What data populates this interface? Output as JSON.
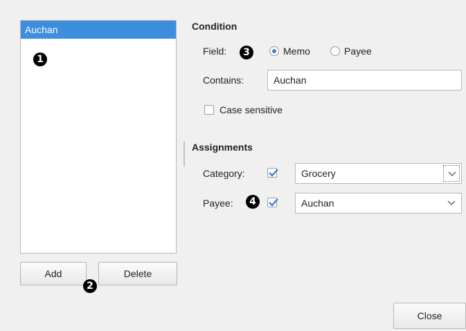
{
  "rules_list": {
    "selected_item": "Auchan"
  },
  "markers": [
    "1",
    "2",
    "3",
    "4"
  ],
  "buttons": {
    "add": "Add",
    "delete": "Delete",
    "close": "Close"
  },
  "condition": {
    "heading": "Condition",
    "field_label": "Field:",
    "field_options": [
      "Memo",
      "Payee"
    ],
    "field_selected": "Memo",
    "contains_label": "Contains:",
    "contains_value": "Auchan",
    "case_sensitive_label": "Case sensitive",
    "case_sensitive_checked": false
  },
  "assignments": {
    "heading": "Assignments",
    "category_label": "Category:",
    "category_checked": true,
    "category_value": "Grocery",
    "payee_label": "Payee:",
    "payee_checked": true,
    "payee_value": "Auchan"
  },
  "colors": {
    "selection": "#3d8fdd",
    "check": "#3d7fd0"
  }
}
